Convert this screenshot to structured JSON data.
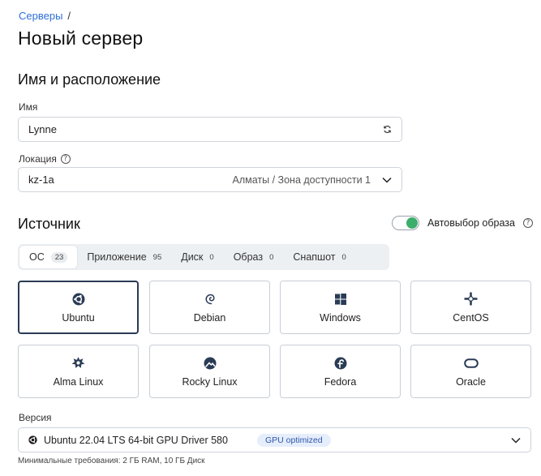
{
  "breadcrumb": {
    "servers": "Серверы",
    "separator": "/"
  },
  "page": {
    "title": "Новый сервер"
  },
  "name_section": {
    "title": "Имя и расположение",
    "name_label": "Имя",
    "name_value": "Lynne",
    "location_label": "Локация",
    "location_value": "kz-1a",
    "location_hint": "Алматы / Зона доступности 1"
  },
  "source_section": {
    "title": "Источник",
    "auto_select_label": "Автовыбор образа",
    "auto_select_on": true,
    "tabs": [
      {
        "label": "ОС",
        "count": "23",
        "active": true
      },
      {
        "label": "Приложение",
        "count": "95"
      },
      {
        "label": "Диск",
        "count": "0"
      },
      {
        "label": "Образ",
        "count": "0"
      },
      {
        "label": "Снапшот",
        "count": "0"
      }
    ],
    "os_options": [
      {
        "name": "Ubuntu",
        "icon": "ubuntu-icon",
        "selected": true
      },
      {
        "name": "Debian",
        "icon": "debian-icon"
      },
      {
        "name": "Windows",
        "icon": "windows-icon"
      },
      {
        "name": "CentOS",
        "icon": "centos-icon"
      },
      {
        "name": "Alma Linux",
        "icon": "almalinux-icon"
      },
      {
        "name": "Rocky Linux",
        "icon": "rockylinux-icon"
      },
      {
        "name": "Fedora",
        "icon": "fedora-icon"
      },
      {
        "name": "Oracle",
        "icon": "oracle-icon"
      }
    ]
  },
  "version": {
    "label": "Версия",
    "value": "Ubuntu 22.04 LTS 64-bit GPU Driver 580",
    "badge": "GPU optimized",
    "min_requirements": "Минимальные требования: 2 ГБ RAM, 10 ГБ Диск"
  },
  "colors": {
    "link": "#2d6fd8",
    "toggle_on": "#3cae6b",
    "selected_border": "#2a3b55",
    "badge_bg": "#e6eefc"
  }
}
